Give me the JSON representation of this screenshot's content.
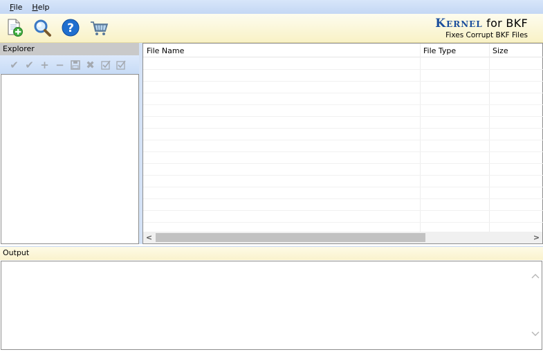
{
  "menu": {
    "items": [
      {
        "label_underlined": "F",
        "label_rest": "ile"
      },
      {
        "label_underlined": "H",
        "label_rest": "elp"
      }
    ]
  },
  "toolbar": {
    "buttons": [
      "open-file-icon",
      "search-icon",
      "help-icon",
      "cart-icon"
    ]
  },
  "brand": {
    "kernel": "Kernel",
    "suffix": " for BKF",
    "tagline": "Fixes Corrupt BKF Files"
  },
  "explorer": {
    "title": "Explorer",
    "tools": [
      "check-icon",
      "check-all-icon",
      "plus-icon",
      "minus-icon",
      "save-icon",
      "delete-icon",
      "checkbox-icon",
      "checkbox-all-icon"
    ]
  },
  "file_list": {
    "columns": [
      "File Name",
      "File Type",
      "Size"
    ]
  },
  "output": {
    "title": "Output"
  },
  "colors": {
    "menubar": "#c4d7f4",
    "toolbar": "#f9f2c6",
    "brand_blue": "#1b4e9c",
    "explorer_header": "#c9c9c9",
    "output_header": "#faf2cd"
  }
}
